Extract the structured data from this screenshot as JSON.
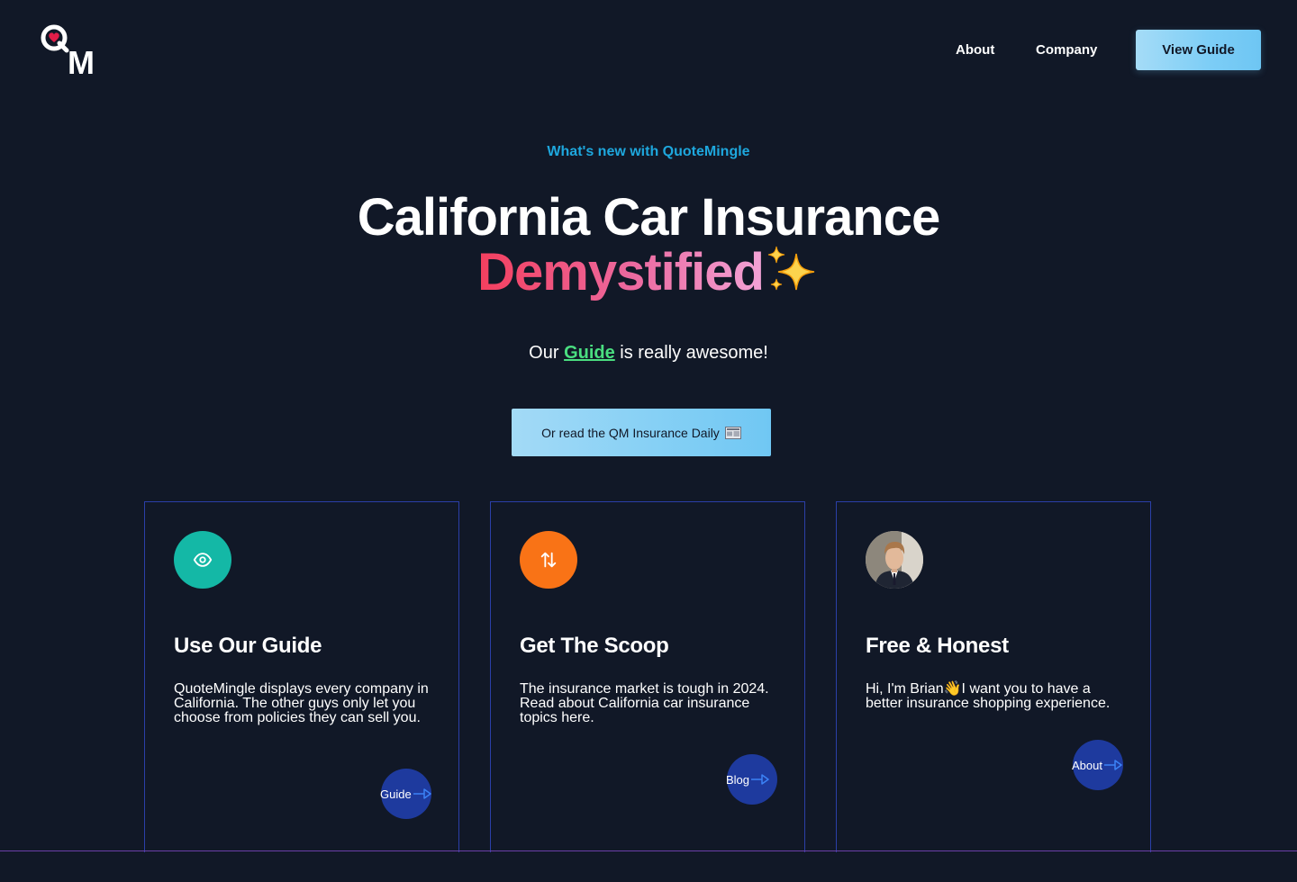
{
  "header": {
    "logo_alt": "QM",
    "nav": {
      "about": "About",
      "company": "Company"
    },
    "view_guide_label": "View Guide"
  },
  "hero": {
    "eyebrow": "What's new with QuoteMingle",
    "title_line1": "California Car Insurance",
    "title_line2": "Demystified",
    "sparkle_icon": "sparkles-icon",
    "subtext_prefix": "Our ",
    "subtext_link": "Guide",
    "subtext_suffix": " is really awesome!",
    "daily_button_label": "Or read the QM Insurance Daily",
    "daily_button_icon": "newspaper-icon"
  },
  "cards": [
    {
      "icon": "eye-icon",
      "icon_color": "#14b8a6",
      "title": "Use Our Guide",
      "text": "QuoteMingle displays every company in California. The other guys only let you choose from policies they can sell you.",
      "cta_label": "Guide"
    },
    {
      "icon": "arrows-up-down-icon",
      "icon_color": "#f97316",
      "title": "Get The Scoop",
      "text": "The insurance market is tough in 2024. Read about California car insurance topics here.",
      "cta_label": "Blog"
    },
    {
      "icon": "avatar",
      "title": "Free & Honest",
      "text": "Hi, I'm Brian👋I want you to have a better insurance shopping experience.",
      "cta_label": "About"
    }
  ],
  "colors": {
    "background": "#111827",
    "accent_blue": "#1ea7dd",
    "link_green": "#4ade80",
    "card_border": "#2b3fa8",
    "cta_circle": "#1e3a9e"
  }
}
